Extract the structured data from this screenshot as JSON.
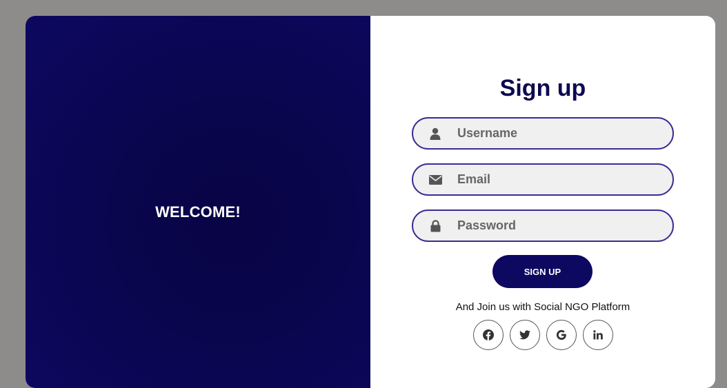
{
  "welcome_panel": {
    "heading": "WELCOME!"
  },
  "form": {
    "title": "Sign up",
    "fields": [
      {
        "placeholder": "Username",
        "value": "",
        "icon": "user-icon"
      },
      {
        "placeholder": "Email",
        "value": "",
        "icon": "envelope-icon"
      },
      {
        "placeholder": "Password",
        "value": "",
        "icon": "lock-icon"
      }
    ],
    "submit_label": "SIGN UP"
  },
  "social": {
    "text": "And Join us with Social NGO Platform",
    "icons": [
      "facebook-icon",
      "twitter-icon",
      "google-icon",
      "linkedin-icon"
    ]
  },
  "colors": {
    "primary": "#0d0860",
    "field_border": "#3b2b93",
    "field_bg": "#f0f0f0",
    "page_bg": "#8e8b8b"
  }
}
